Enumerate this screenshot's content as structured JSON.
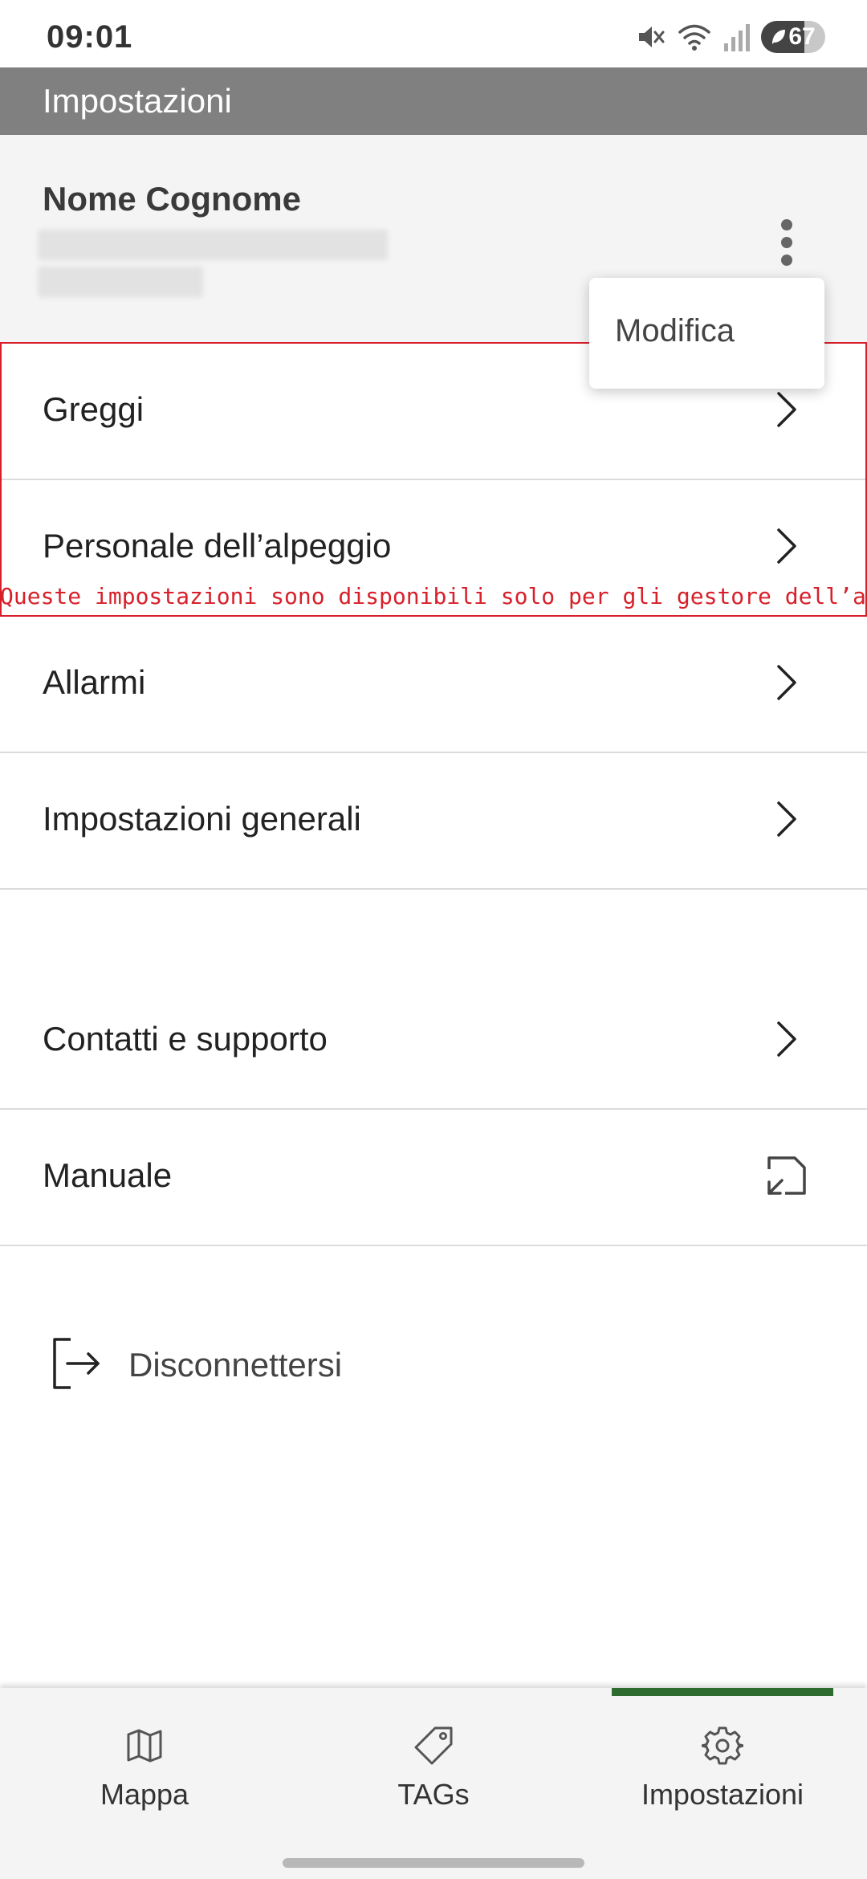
{
  "status_bar": {
    "time": "09:01",
    "battery_level": "67",
    "battery_percent": 67,
    "icons": [
      "mute-icon",
      "wifi-icon",
      "signal-icon",
      "battery-icon",
      "leaf-icon"
    ]
  },
  "app_bar": {
    "title": "Impostazioni"
  },
  "profile": {
    "name": "Nome Cognome",
    "menu_icon": "more-vert-icon"
  },
  "popup_menu": {
    "items": [
      {
        "label": "Modifica"
      }
    ]
  },
  "settings_list": {
    "items": [
      {
        "label": "Greggi",
        "icon": "chevron-right-icon"
      },
      {
        "label": "Personale dell’alpeggio",
        "icon": "chevron-right-icon"
      },
      {
        "label": "Allarmi",
        "icon": "chevron-right-icon"
      },
      {
        "label": "Impostazioni generali",
        "icon": "chevron-right-icon"
      },
      {
        "label": "Contatti e supporto",
        "icon": "chevron-right-icon"
      },
      {
        "label": "Manuale",
        "icon": "external-link-icon"
      }
    ],
    "restricted_note": "Queste impostazioni sono disponibili solo per gli gestore dell’alpeggio."
  },
  "logout": {
    "label": "Disconnettersi",
    "icon": "logout-icon"
  },
  "bottom_nav": {
    "items": [
      {
        "label": "Mappa",
        "icon": "map-icon"
      },
      {
        "label": "TAGs",
        "icon": "tag-icon"
      },
      {
        "label": "Impostazioni",
        "icon": "gear-icon",
        "active": true
      }
    ]
  },
  "colors": {
    "app_bar": "#808080",
    "restricted": "#d7202a",
    "active_tab_indicator": "#2e6b2e",
    "profile_background": "#f4f4f4"
  }
}
